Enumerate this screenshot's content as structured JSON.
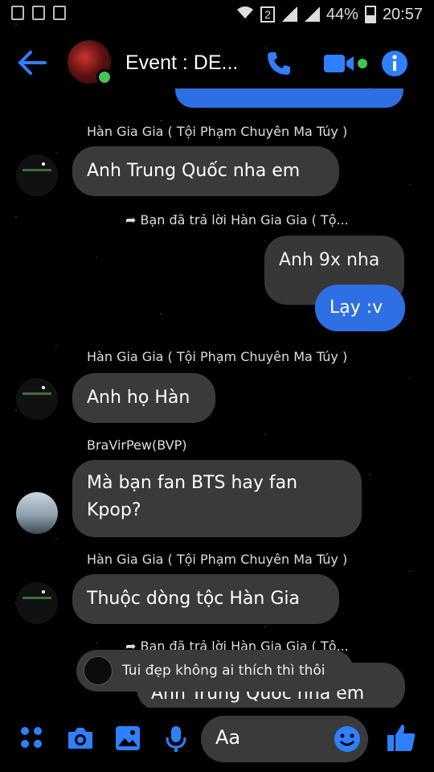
{
  "status_bar": {
    "signal_sim": "2",
    "battery": "44%",
    "time": "20:57"
  },
  "header": {
    "title": "Event : DE..."
  },
  "messages": {
    "m1_sender": "Hàn Gia Gia ( Tội Phạm Chuyên Ma Túy )",
    "m1_text": "Anh Trung Quốc nha em",
    "reply_note": "Bạn đã trả lời Hàn Gia Gia ( Tộ...",
    "m2_text": "Anh 9x nha",
    "m3_text": "Lạy :v",
    "m4_sender": "Hàn Gia Gia ( Tội Phạm Chuyên Ma Túy )",
    "m4_text": "Anh họ Hàn",
    "m5_sender": "BraVirPew(BVP)",
    "m5_line1": "Mà bạn fan BTS hay fan",
    "m5_line2": "Kpop?",
    "m6_sender": "Hàn Gia Gia ( Tội Phạm Chuyên Ma Túy )",
    "m6_text": "Thuộc dòng tộc Hàn Gia",
    "reply_note2": "Bạn đã trả lời Hàn Gia Gia ( Tộ...",
    "m7_text": "Anh Trung Quốc nha em"
  },
  "toast": {
    "text": "Tui đẹp không ai thích thì thôi"
  },
  "composer": {
    "placeholder": "Aa"
  },
  "colors": {
    "accent": "#2f6fe4",
    "bubble": "#3a3a3c",
    "online": "#44c553"
  },
  "icons": [
    "back-arrow-icon",
    "phone-icon",
    "video-icon",
    "info-icon",
    "grid-dots-icon",
    "camera-icon",
    "image-icon",
    "microphone-icon",
    "emoji-icon",
    "like-icon"
  ]
}
